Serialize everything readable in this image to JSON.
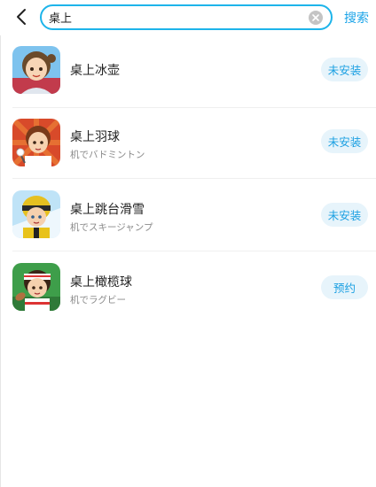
{
  "search": {
    "value": "桌上",
    "submit_label": "搜索"
  },
  "apps": [
    {
      "name": "桌上冰壶",
      "subtitle": "",
      "status": "未安装",
      "icon": "curling-girl-avatar-icon"
    },
    {
      "name": "桌上羽球",
      "subtitle": "机でバドミントン",
      "status": "未安装",
      "icon": "badminton-boy-avatar-icon"
    },
    {
      "name": "桌上跳台滑雪",
      "subtitle": "机でスキージャンプ",
      "status": "未安装",
      "icon": "ski-jump-boy-avatar-icon"
    },
    {
      "name": "桌上橄榄球",
      "subtitle": "机でラグビー",
      "status": "预约",
      "icon": "rugby-boy-avatar-icon"
    }
  ],
  "colors": {
    "accent": "#1aa3e8",
    "search_border": "#1db4ea",
    "status_bg": "#e7f4fb"
  }
}
